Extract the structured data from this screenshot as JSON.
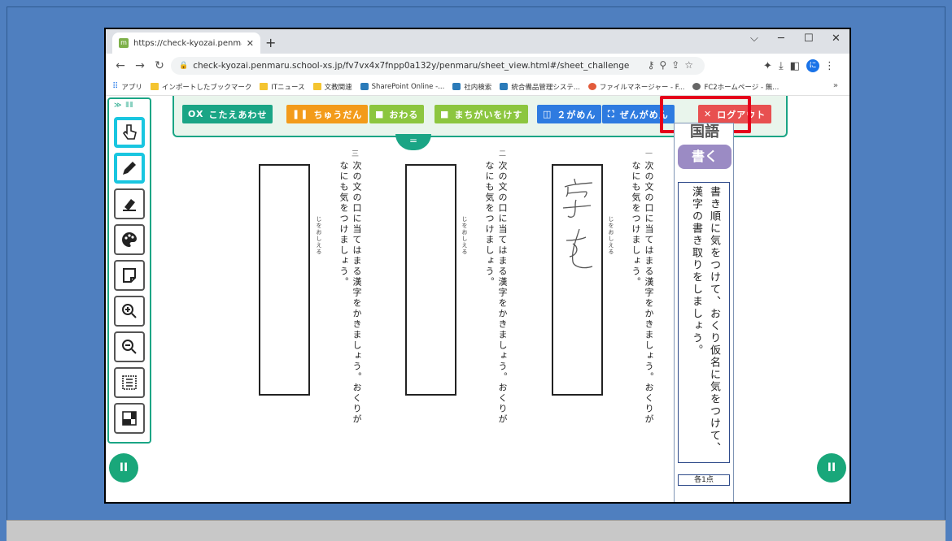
{
  "browser": {
    "tab_title": "https://check-kyozai.penmaru.sc",
    "tab_close": "✕",
    "new_tab": "+",
    "window_controls": [
      "⌵",
      "─",
      "☐",
      "✕"
    ],
    "url": "check-kyozai.penmaru.school-xs.jp/fv7vx4x7fnpp0a132y/penmaru/sheet_view.html#/sheet_challenge",
    "profile_initial": "に",
    "bookmarks": [
      {
        "label": "アプリ",
        "icon": "apps-grid-icon"
      },
      {
        "label": "インポートしたブックマーク",
        "icon": "folder-icon"
      },
      {
        "label": "ITニュース",
        "icon": "folder-icon"
      },
      {
        "label": "文教関連",
        "icon": "folder-icon"
      },
      {
        "label": "SharePoint Online -...",
        "icon": "sharepoint-icon"
      },
      {
        "label": "社内検索",
        "icon": "sharepoint-icon"
      },
      {
        "label": "統合備品管理システ...",
        "icon": "sharepoint-icon"
      },
      {
        "label": "ファイルマネージャー - F...",
        "icon": "file-manager-icon"
      },
      {
        "label": "FC2ホームページ - 無...",
        "icon": "globe-icon"
      }
    ],
    "bookmarks_more": "»"
  },
  "menu": {
    "kotaeawase": "こたえあわせ",
    "chuudan": "ちゅうだん",
    "owaru": "おわる",
    "machigai": "まちがいをけす",
    "nigamen": "２がめん",
    "zengamen": "ぜんがめん",
    "logout": "ログアウト",
    "toggle": "="
  },
  "colors": {
    "teal": "#1aa585",
    "orange": "#f39b1a",
    "green": "#8cc63f",
    "blue": "#2e7be0",
    "red": "#e85050",
    "highlight": "#e5001b"
  },
  "sheet": {
    "subject": "国語",
    "tag": "書く",
    "instruction": "書き順に気をつけて、おくり仮名に気をつけて、漢字の書き取りをしましょう。",
    "points": "各1点",
    "questions": [
      {
        "text": "次の文の口に当てはまる漢字をかきましょう。おくりがなにも気をつけましょう。",
        "hint": "じをおしえる",
        "number": "三"
      },
      {
        "text": "次の文の口に当てはまる漢字をかきましょう。おくりがなにも気をつけましょう。",
        "hint": "じをおしえる",
        "number": "二"
      },
      {
        "text": "次の文の口に当てはまる漢字をかきましょう。おくりがなにも気をつけましょう。",
        "hint": "じをおしえる",
        "number": "一"
      }
    ]
  },
  "left_tools": [
    "hand-pointer-icon",
    "pen-icon",
    "eraser-icon",
    "palette-icon",
    "sticky-note-icon",
    "zoom-in-icon",
    "zoom-out-icon",
    "page-list-icon",
    "layout-icon"
  ],
  "pause_label": "II"
}
